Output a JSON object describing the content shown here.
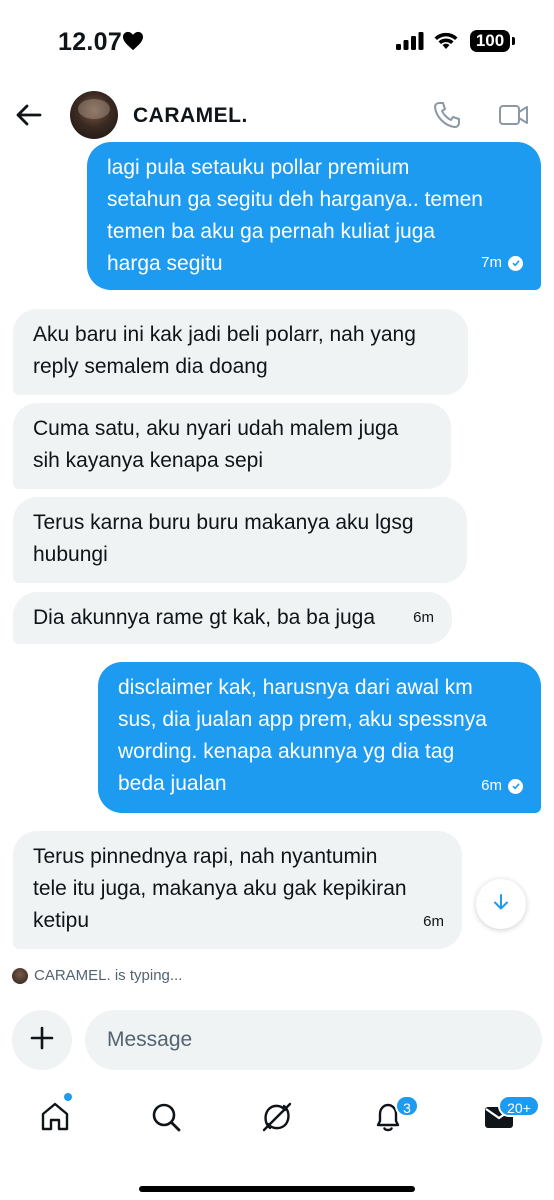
{
  "status_bar": {
    "time": "12.07",
    "battery": "100"
  },
  "header": {
    "contact_name": "CARAMEL."
  },
  "messages": [
    {
      "direction": "out",
      "lines": [
        "lagi pula setauku pollar premium",
        "setahun ga segitu deh harganya.. temen",
        "temen ba aku ga pernah kuliat juga",
        "harga segitu"
      ],
      "time": "7m",
      "seen": true
    },
    {
      "direction": "in",
      "lines": [
        "Aku baru ini kak jadi beli polarr, nah yang",
        "reply semalem dia doang"
      ]
    },
    {
      "direction": "in",
      "lines": [
        "Cuma satu, aku nyari udah malem juga",
        "sih kayanya kenapa sepi"
      ]
    },
    {
      "direction": "in",
      "lines": [
        "Terus karna buru buru makanya aku lgsg",
        "hubungi"
      ]
    },
    {
      "direction": "in",
      "lines": [
        "Dia akunnya rame gt kak, ba ba juga"
      ],
      "time": "6m"
    },
    {
      "direction": "out",
      "lines": [
        "disclaimer kak, harusnya dari awal km",
        "sus, dia jualan app prem, aku spessnya",
        "wording. kenapa akunnya yg dia tag",
        "beda jualan"
      ],
      "time": "6m",
      "seen": true
    },
    {
      "direction": "in",
      "lines": [
        "Terus pinnednya rapi, nah nyantumin",
        "tele itu juga, makanya aku gak kepikiran",
        "ketipu"
      ],
      "time": "6m"
    }
  ],
  "typing_indicator": "CARAMEL. is typing...",
  "composer": {
    "placeholder": "Message"
  },
  "tabbar": {
    "notifications_badge": "3",
    "messages_badge": "20+"
  },
  "colors": {
    "accent": "#1d9bf0",
    "incoming_bubble": "#eff3f4",
    "text": "#0f1419",
    "muted": "#536471"
  }
}
